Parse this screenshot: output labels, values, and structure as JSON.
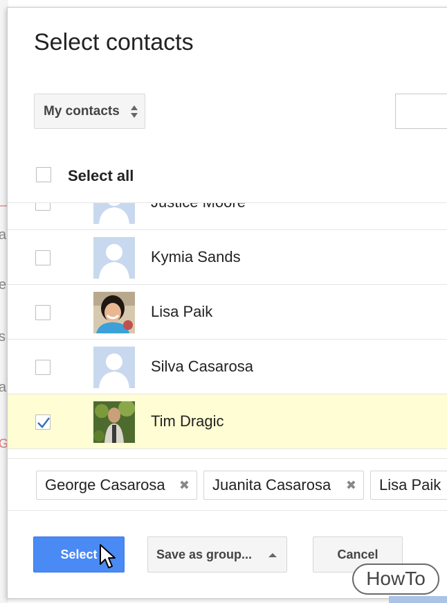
{
  "dialog": {
    "title": "Select contacts",
    "group_dropdown": {
      "label": "My contacts"
    },
    "select_all_label": "Select all"
  },
  "contacts": [
    {
      "name": "Justice Moore",
      "checked": false,
      "avatar": "placeholder-avatar-icon"
    },
    {
      "name": "Kymia Sands",
      "checked": false,
      "avatar": "placeholder-avatar-icon"
    },
    {
      "name": "Lisa Paik",
      "checked": false,
      "avatar": "photo"
    },
    {
      "name": "Silva Casarosa",
      "checked": false,
      "avatar": "placeholder-avatar-icon"
    },
    {
      "name": "Tim Dragic",
      "checked": true,
      "avatar": "photo"
    }
  ],
  "selected_chips": [
    {
      "label": "George Casarosa"
    },
    {
      "label": "Juanita Casarosa"
    },
    {
      "label": "Lisa Paik"
    }
  ],
  "buttons": {
    "select": "Select",
    "save_as_group": "Save as group...",
    "cancel": "Cancel"
  },
  "watermark": "HowTo",
  "colors": {
    "primary_button": "#4a8af4",
    "selected_row": "#fffdd4",
    "avatar_placeholder": "#c8d8ee",
    "check_mark": "#3b6fb6"
  }
}
